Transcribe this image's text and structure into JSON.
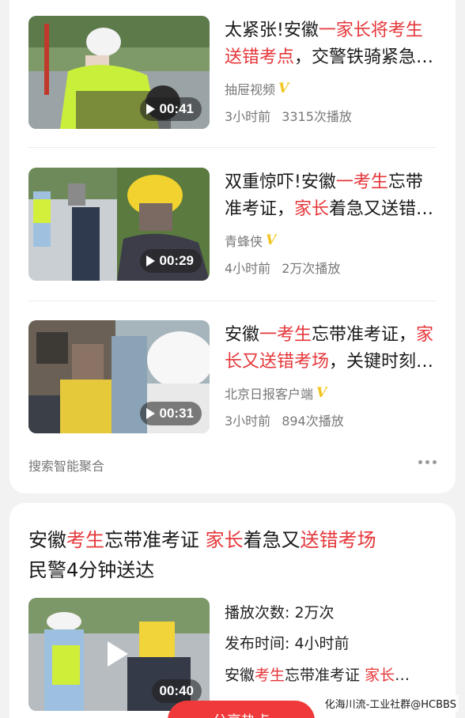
{
  "results": [
    {
      "title_parts": [
        {
          "text": "太紧张!安徽",
          "hl": false
        },
        {
          "text": "一家长将考生送错考点",
          "hl": true
        },
        {
          "text": "，交警铁骑紧急送考",
          "hl": false
        }
      ],
      "source": "抽屉视频",
      "verified": "V",
      "time": "3小时前",
      "plays": "3315次播放",
      "duration": "00:41"
    },
    {
      "title_parts": [
        {
          "text": "双重惊吓!安徽",
          "hl": false
        },
        {
          "text": "一考生",
          "hl": true
        },
        {
          "text": "忘带准考证，",
          "hl": false
        },
        {
          "text": "家长",
          "hl": true
        },
        {
          "text": "着急又送错考场",
          "hl": false
        }
      ],
      "source": "青蜂侠",
      "verified": "V",
      "time": "4小时前",
      "plays": "2万次播放",
      "duration": "00:29"
    },
    {
      "title_parts": [
        {
          "text": "安徽",
          "hl": false
        },
        {
          "text": "一考生",
          "hl": true
        },
        {
          "text": "忘带准考证，",
          "hl": false
        },
        {
          "text": "家长又送错考场",
          "hl": true
        },
        {
          "text": "，关键时刻民警出手",
          "hl": false
        }
      ],
      "source": "北京日报客户端",
      "verified": "V",
      "time": "3小时前",
      "plays": "894次播放",
      "duration": "00:31"
    }
  ],
  "aggregate_label": "搜索智能聚合",
  "feature": {
    "title_parts": [
      {
        "text": "安徽",
        "hl": false
      },
      {
        "text": "考生",
        "hl": true
      },
      {
        "text": "忘带准考证 ",
        "hl": false
      },
      {
        "text": "家长",
        "hl": true
      },
      {
        "text": "着急又",
        "hl": false
      },
      {
        "text": "送错考场",
        "hl": true
      },
      {
        "text": "民警4分钟送达",
        "hl": false
      }
    ],
    "duration": "00:40",
    "play_count": "播放次数: 2万次",
    "publish_time": "发布时间: 4小时前",
    "desc_parts": [
      {
        "text": "安徽",
        "hl": false
      },
      {
        "text": "考生",
        "hl": true
      },
      {
        "text": "忘带准考证 ",
        "hl": false
      },
      {
        "text": "家长",
        "hl": true
      },
      {
        "text": "…",
        "hl": false
      }
    ],
    "share_label": "分享热点"
  },
  "watermark": "化海川流-工业社群@HCBBS",
  "colors": {
    "highlight": "#e5373a",
    "verified": "#f0c419",
    "share": "#f0393a"
  }
}
